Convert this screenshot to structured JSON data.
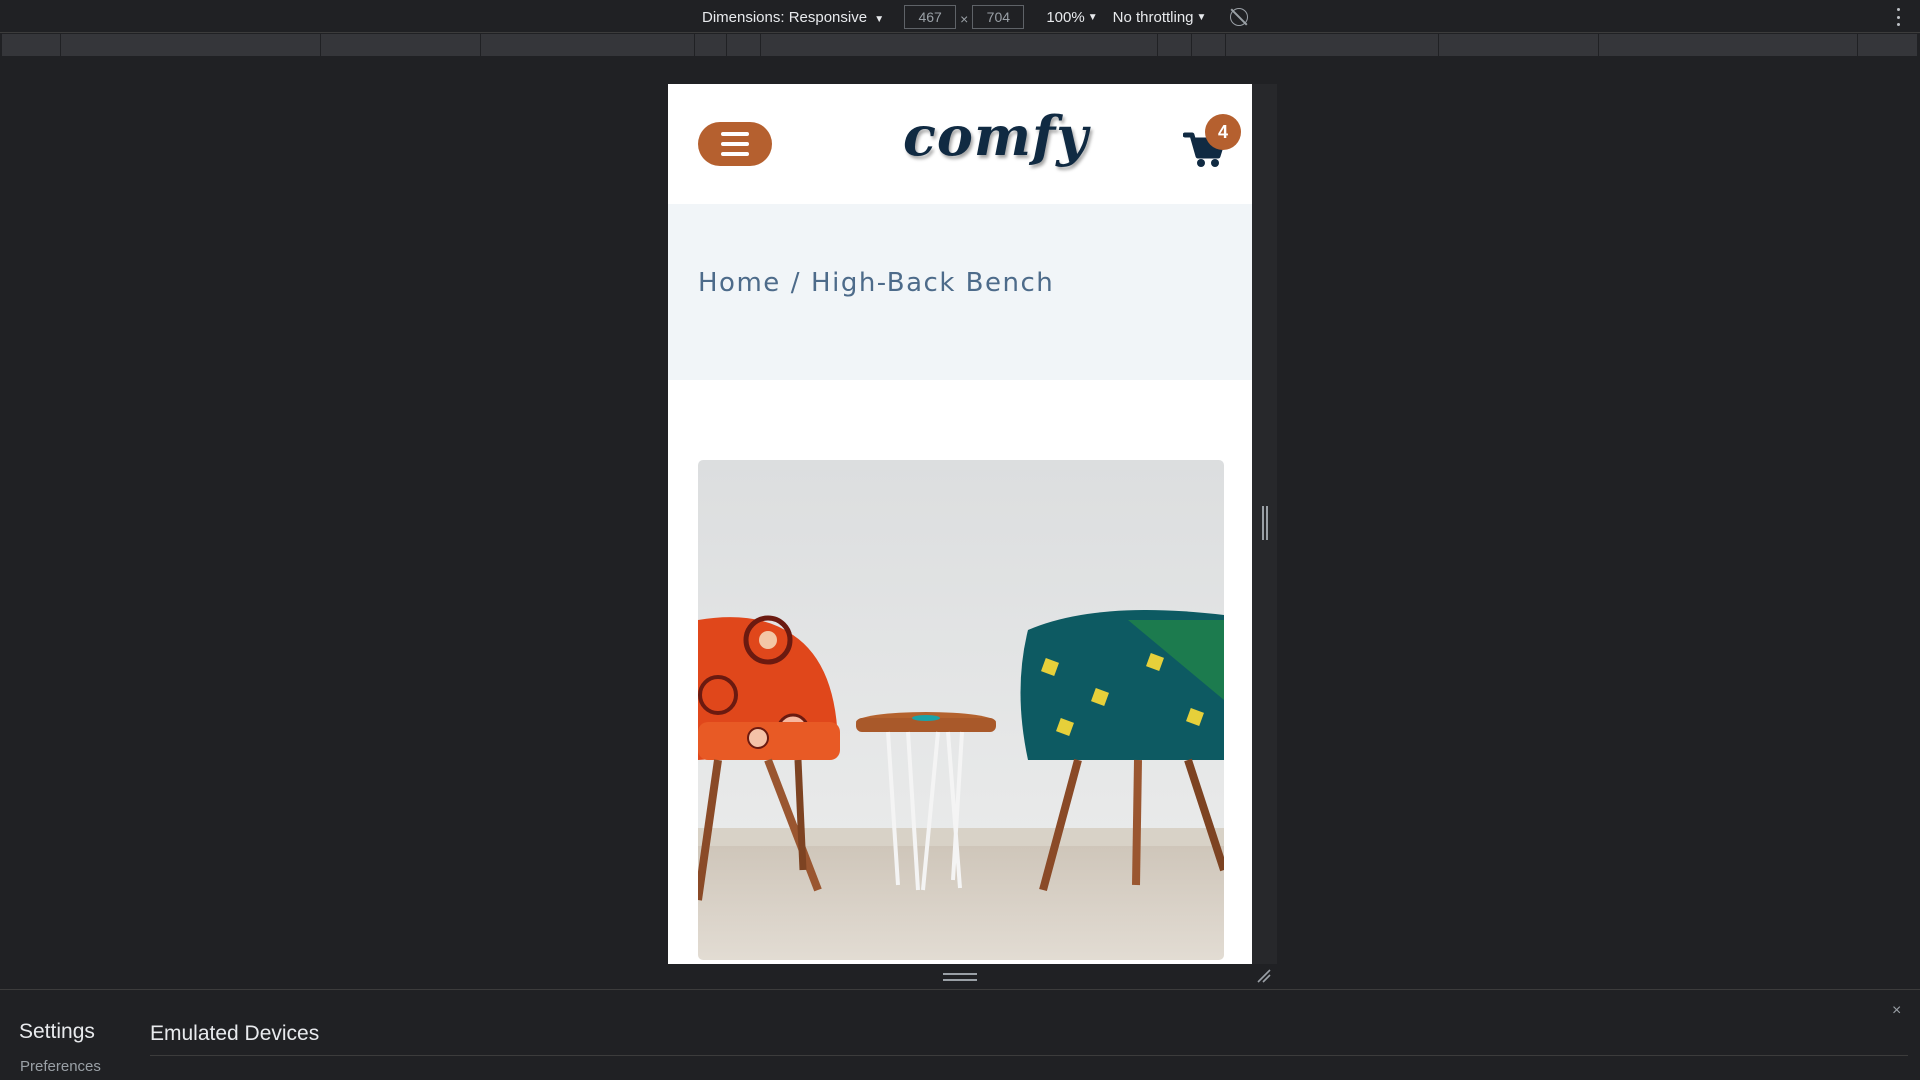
{
  "devtools": {
    "dimensions_label": "Dimensions: Responsive",
    "width_value": "467",
    "height_value": "704",
    "times": "×",
    "zoom": "100%",
    "throttling": "No throttling",
    "caret": "▼"
  },
  "site": {
    "logo": "comfy",
    "cart_count": "4",
    "breadcrumb": {
      "home": "Home",
      "separator": "/",
      "current": "High-Back Bench"
    },
    "colors": {
      "accent": "#b5602f",
      "navy": "#102a42",
      "hero_bg": "#f1f5f8",
      "crumb": "#4d6b8a"
    }
  },
  "settings_panel": {
    "title": "Settings",
    "preferences": "Preferences",
    "section": "Emulated Devices",
    "close": "×"
  }
}
